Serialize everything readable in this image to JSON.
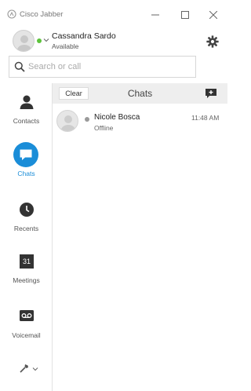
{
  "window": {
    "title": "Cisco Jabber"
  },
  "user": {
    "name": "Cassandra Sardo",
    "status": "Available",
    "presence_color": "#5cc33b"
  },
  "search": {
    "placeholder": "Search or call",
    "value": ""
  },
  "nav": {
    "items": [
      {
        "label": "Contacts",
        "icon": "person-icon",
        "active": false
      },
      {
        "label": "Chats",
        "icon": "chat-bubble-icon",
        "active": true
      },
      {
        "label": "Recents",
        "icon": "clock-icon",
        "active": false
      },
      {
        "label": "Meetings",
        "icon": "calendar-icon",
        "date": "31",
        "active": false
      },
      {
        "label": "Voicemail",
        "icon": "voicemail-icon",
        "active": false
      }
    ]
  },
  "chats_panel": {
    "clear_label": "Clear",
    "title": "Chats",
    "conversations": [
      {
        "name": "Nicole Bosca",
        "status": "Offline",
        "time": "11:48 AM",
        "presence_color": "#9a9a9a"
      }
    ]
  },
  "colors": {
    "accent": "#1a8dd8",
    "toolbar_bg": "#eeeeee"
  }
}
